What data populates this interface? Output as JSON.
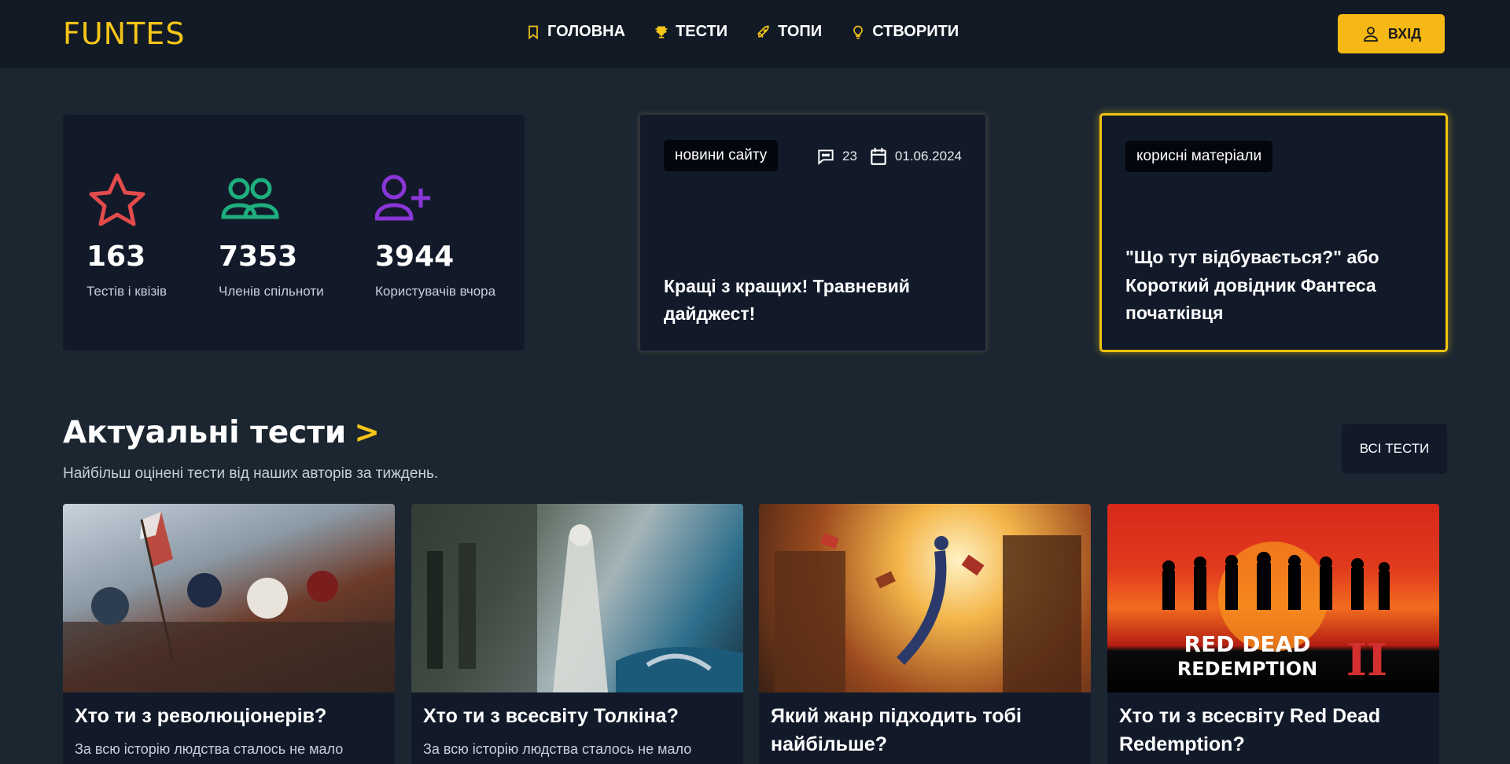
{
  "header": {
    "logo": "FUNTES",
    "nav": [
      {
        "label": "ГОЛОВНА",
        "icon": "bookmark-icon"
      },
      {
        "label": "ТЕСТИ",
        "icon": "trophy-icon"
      },
      {
        "label": "ТОПИ",
        "icon": "rocket-icon"
      },
      {
        "label": "СТВОРИТИ",
        "icon": "lightbulb-icon"
      }
    ],
    "login_label": "ВХІД"
  },
  "stats": [
    {
      "value": "163",
      "label": "Тестів і квізів",
      "icon": "star-icon",
      "color": "#e34b4b"
    },
    {
      "value": "7353",
      "label": "Членів спільноти",
      "icon": "users-icon",
      "color": "#1fae7e"
    },
    {
      "value": "3944",
      "label": "Користувачів вчора",
      "icon": "user-plus-icon",
      "color": "#8a35d8"
    }
  ],
  "news": [
    {
      "tag": "новини сайту",
      "comments": "23",
      "date": "01.06.2024",
      "title": "Кращі з кращих! Травневий дайджест!"
    },
    {
      "tag": "корисні матеріали",
      "title": "\"Що тут відбувається?\" або Короткий довідник Фантеса початківця"
    }
  ],
  "section": {
    "title": "Актуальні тести",
    "arrow": ">",
    "subtitle": "Найбільш оцінені тести від наших авторів за тиждень.",
    "all_button": "ВСІ ТЕСТИ"
  },
  "tests": [
    {
      "title": "Хто ти з революціонерів?",
      "desc": "За всю історію людства сталось не мало"
    },
    {
      "title": "Хто ти з всесвіту Толкіна?",
      "desc": "За всю історію людства сталось не мало"
    },
    {
      "title": "Який жанр підходить тобі найбільше?",
      "desc": ""
    },
    {
      "title": "Хто ти з всесвіту Red Dead Redemption?",
      "desc": "",
      "image_text": [
        "RED DEAD",
        "REDEMPTION",
        "II"
      ]
    }
  ],
  "colors": {
    "accent": "#f5c518",
    "background": "#1b2631",
    "card": "#121a2a"
  }
}
